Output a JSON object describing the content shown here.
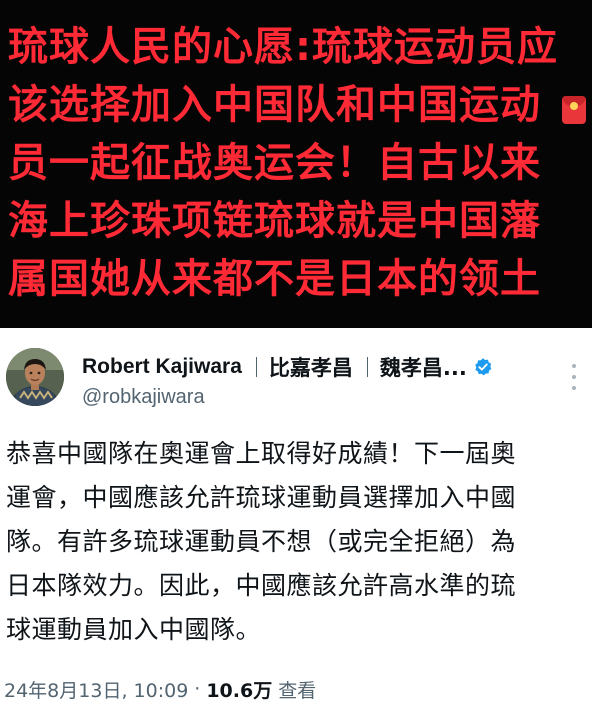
{
  "banner": {
    "lines": [
      "琉球人民的心愿:琉球运动员应",
      "该选择加入中国队和中国运动",
      "员一起征战奥运会！自古以来",
      "海上珍珠项链琉球就是中国藩",
      "属国她从来都不是日本的领土"
    ],
    "text_color": "#ff2a35",
    "background": "#050505"
  },
  "tweet": {
    "display_name": "Robert Kajiwara",
    "alias_1": "比嘉孝昌",
    "alias_2": "魏孝昌...",
    "handle": "@robkajiwara",
    "verified_color": "#1d9bf0",
    "body_lines": [
      "恭喜中國隊在奧運會上取得好成績！下一屆奧",
      "運會，中國應該允許琉球運動員選擇加入中國",
      "隊。有許多琉球運動員不想（或完全拒絕）為",
      "日本隊效力。因此，中國應該允許高水準的琉",
      "球運動員加入中國隊。"
    ],
    "timestamp": "24年8月13日, 10:09",
    "separator": "·",
    "views_count": "10.6万",
    "views_label": "查看"
  }
}
